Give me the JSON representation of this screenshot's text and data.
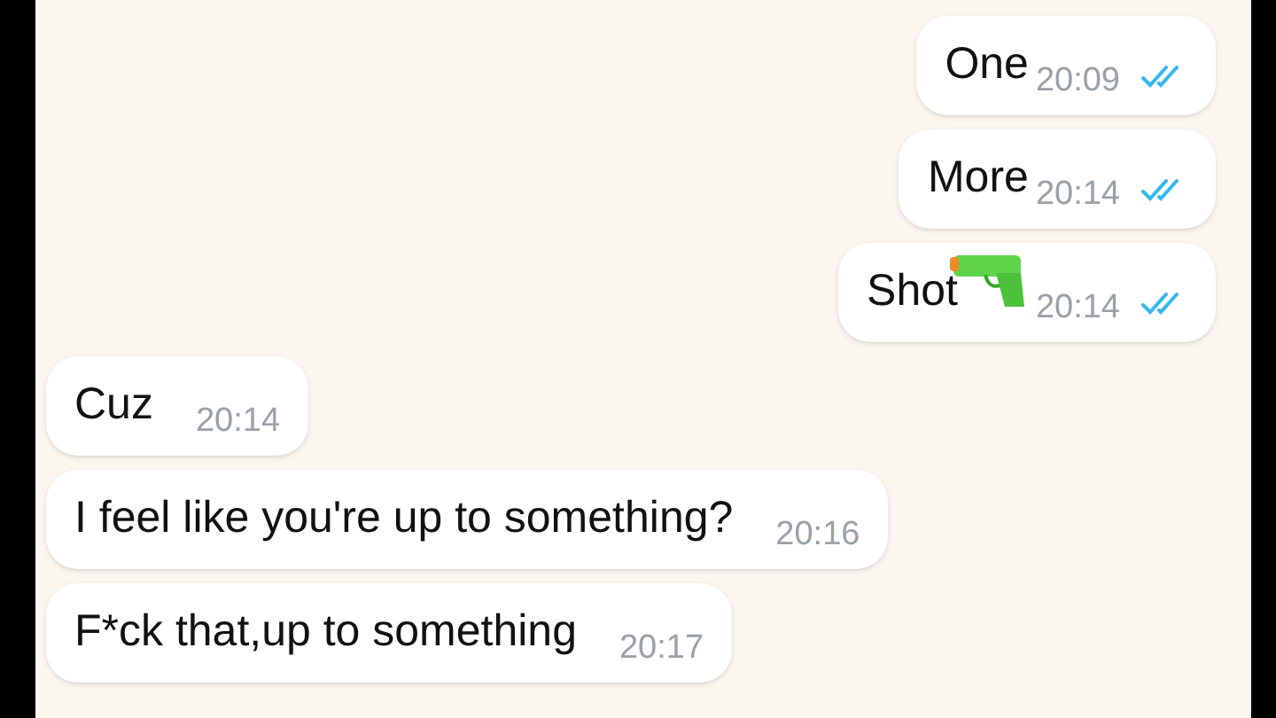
{
  "messages": [
    {
      "kind": "outgoing",
      "text": "One",
      "time": "20:09",
      "read": true
    },
    {
      "kind": "outgoing",
      "text": "More",
      "time": "20:14",
      "read": true
    },
    {
      "kind": "outgoing",
      "text": "Shot",
      "pistol_icon": true,
      "time": "20:14",
      "read": true
    },
    {
      "kind": "incoming",
      "text": "Cuz",
      "time": "20:14"
    },
    {
      "kind": "incoming",
      "text": "I feel like you're up to something?",
      "time": "20:16"
    },
    {
      "kind": "incoming",
      "text": "F*ck that,up to something",
      "time": "20:17"
    }
  ]
}
